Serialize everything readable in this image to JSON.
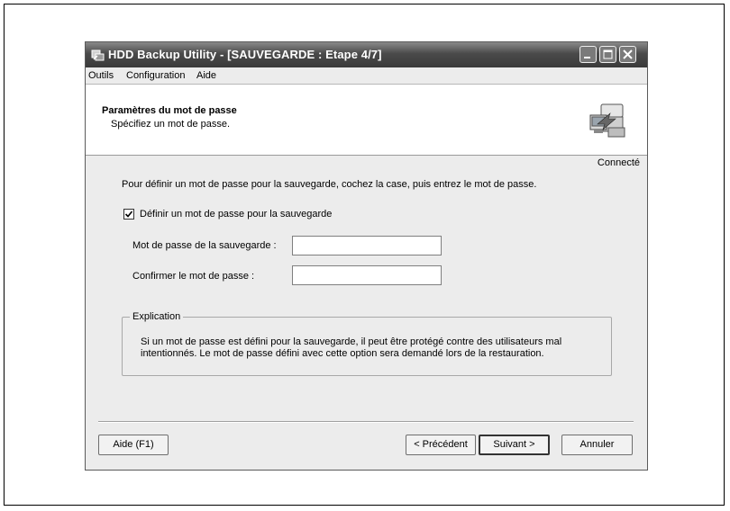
{
  "window": {
    "title": "HDD Backup Utility - [SAUVEGARDE : Etape 4/7]",
    "icon": "backup-utility-icon",
    "controls": [
      "minimize",
      "maximize",
      "close"
    ]
  },
  "menu": {
    "items": [
      "Outils",
      "Configuration",
      "Aide"
    ]
  },
  "header": {
    "title": "Paramètres du mot de passe",
    "subtitle": "Spécifiez un mot de passe.",
    "icon": "printer-backup-icon"
  },
  "status": "Connecté",
  "instruction": "Pour définir un mot de passe pour la sauvegarde, cochez la case, puis entrez le mot de passe.",
  "checkbox": {
    "label": "Définir un mot de passe pour la sauvegarde",
    "checked": true
  },
  "fields": {
    "password": {
      "label": "Mot de passe de la sauvegarde :",
      "value": ""
    },
    "confirm": {
      "label": "Confirmer le mot de passe :",
      "value": ""
    }
  },
  "explanation": {
    "legend": "Explication",
    "text": "Si un mot de passe est défini pour la sauvegarde, il peut être protégé contre des utilisateurs mal intentionnés. Le mot de passe défini avec cette option sera demandé lors de la restauration."
  },
  "buttons": {
    "help": "Aide (F1)",
    "previous": "< Précédent",
    "next": "Suivant >",
    "cancel": "Annuler"
  }
}
